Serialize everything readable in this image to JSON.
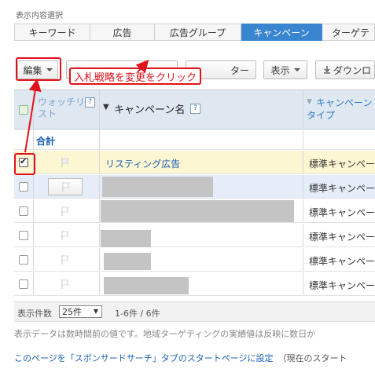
{
  "display_select": {
    "label": "表示内容選択"
  },
  "tabs": [
    {
      "label": "キーワード",
      "active": false
    },
    {
      "label": "広告",
      "active": false
    },
    {
      "label": "広告グループ",
      "active": false
    },
    {
      "label": "キャンペーン",
      "active": true
    },
    {
      "label": "ターゲテ",
      "active": false
    }
  ],
  "toolbar": {
    "edit_label": "編集",
    "filter_label": "ター",
    "view_label": "表示",
    "download_label": "ダウンロ"
  },
  "annotation": {
    "callout_text": "入札戦略を変更をクリック"
  },
  "table": {
    "headers": {
      "watch": "ウォッチリスト",
      "help": "?",
      "campaign_name": "キャンペーン名",
      "campaign_type": "キャンペーンタイプ"
    },
    "total_label": "合計",
    "rows": [
      {
        "checked": true,
        "name": "リスティング広告",
        "type": "標準キャンペー"
      },
      {
        "checked": false,
        "name": "",
        "type": "標準キャンペー"
      },
      {
        "checked": false,
        "name": "",
        "type": "標準キャンペー"
      },
      {
        "checked": false,
        "name": "",
        "type": "標準キャンペー"
      },
      {
        "checked": false,
        "name": "",
        "type": "標準キャンペー"
      },
      {
        "checked": false,
        "name": "",
        "type": "標準キャンペー"
      }
    ]
  },
  "pager": {
    "count_label": "表示件数",
    "per_page": "25件",
    "range": "1-6件 / 6件"
  },
  "notes": {
    "data_note": "表示データは数時間前の値です。地域ターゲティングの実績値は反映に数日か",
    "start_page_link": "このページを「スポンサードサーチ」タブのスタートページに設定",
    "current_start": "（現在のスタート"
  },
  "colors": {
    "accent": "#3a85cf",
    "annotation": "#e0121a",
    "link": "#1a5fb4"
  }
}
